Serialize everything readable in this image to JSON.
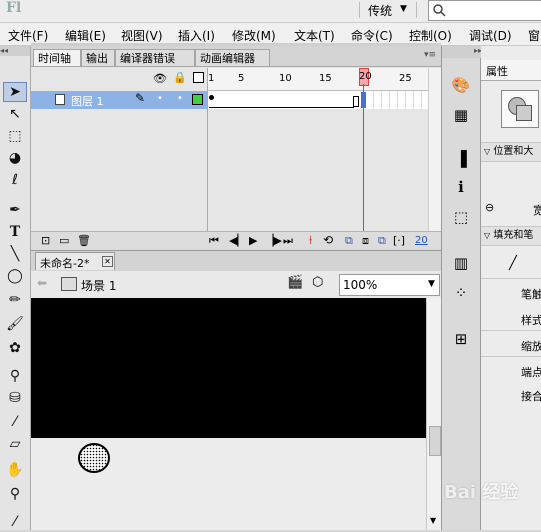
{
  "app_logo": "Fl",
  "workspace": {
    "label": "传统",
    "arrow": "▼"
  },
  "search": {
    "placeholder": "",
    "icon": "search-icon"
  },
  "menu": [
    "文件(F)",
    "编辑(E)",
    "视图(V)",
    "插入(I)",
    "修改(M)",
    "文本(T)",
    "命令(C)",
    "控制(O)",
    "调试(D)",
    "窗"
  ],
  "timeline_tabs": [
    "时间轴",
    "输出",
    "编译器错误",
    "动画编辑器"
  ],
  "frame_ruler": [
    "1",
    "5",
    "10",
    "15",
    "20",
    "25"
  ],
  "layer": {
    "name": "图层 1"
  },
  "playhead_frame": "20",
  "current_frame_readout": "20",
  "doc_tab": {
    "name": "未命名-2*"
  },
  "scene": {
    "name": "场景 1"
  },
  "zoom": "100%",
  "properties": {
    "tab": "属性",
    "section_position": "位置和大",
    "width_label": "宽",
    "section_fill": "填充和笔",
    "stroke_label": "笔触",
    "style_label": "样式",
    "scale_label": "缩放",
    "cap_label": "端点",
    "join_label": "接合"
  },
  "watermark": "Bai 经验",
  "colors": {
    "stage": "#000000",
    "layer_highlight": "#8db2e6",
    "playhead": "#e03c3c"
  }
}
